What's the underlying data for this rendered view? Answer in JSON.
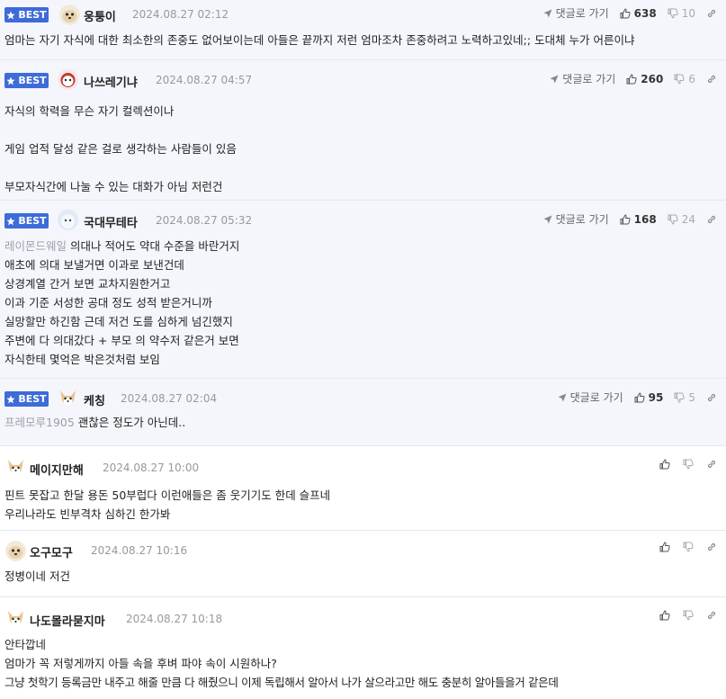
{
  "best_label": "BEST",
  "reply_label": "댓글로 가기",
  "comments": [
    {
      "nick": "웅퉁이",
      "date": "2024.08.27 02:12",
      "up": "638",
      "down": "10",
      "lines": [
        "엄마는 자기 자식에 대한 최소한의 존중도 없어보이는데 아들은 끝까지 저런 엄마조차 존중하려고 노력하고있네;; 도대체 누가 어른이냐"
      ]
    },
    {
      "nick": "나쓰레기냐",
      "date": "2024.08.27 04:57",
      "up": "260",
      "down": "6",
      "lines": [
        "자식의 학력을 무슨 자기 컬렉션이나",
        "게임 업적 달성 같은 걸로 생각하는 사람들이 있음",
        "부모자식간에 나눌 수 있는 대화가 아님 저런건"
      ]
    },
    {
      "nick": "국대무테타",
      "date": "2024.08.27 05:32",
      "up": "168",
      "down": "24",
      "mention": "레이몬드웨일",
      "lines": [
        "의대나 적어도 약대 수준을 바란거지",
        "애초에 의대 보낼거면 이과로 보낸건데",
        "상경계열 간거 보면 교차지원한거고",
        "이과 기준 서성한 공대 정도 성적 받은거니까",
        "실망할만 하긴함 근데 저건 도를 심하게 넘긴했지",
        "주변에 다 의대갔다 + 부모 의 약수저 같은거 보면",
        "자식한테 몇억은 박은것처럼 보임"
      ]
    },
    {
      "nick": "케칭",
      "date": "2024.08.27 02:04",
      "up": "95",
      "down": "5",
      "mention": "프레모루1905",
      "lines": [
        "괜찮은 정도가 아닌데.."
      ]
    },
    {
      "nick": "메이지만해",
      "date": "2024.08.27 10:00",
      "lines": [
        "핀트 못잡고 한달 용돈 50부럽다 이런애들은 좀 웃기기도 한데 슬프네",
        "우리나라도 빈부격차 심하긴 한가봐"
      ]
    },
    {
      "nick": "오구모구",
      "date": "2024.08.27 10:16",
      "lines": [
        "정병이네 저건"
      ]
    },
    {
      "nick": "나도몰라묻지마",
      "date": "2024.08.27 10:18",
      "lines": [
        "안타깝네",
        "엄마가 꼭 저렇게까지 아들 속을 후벼 파야 속이 시원하나?",
        "그냥 첫학기 등록금만 내주고 해줄 만큼 다 해줬으니 이제 독립해서 알아서 나가 살으라고만 해도 충분히 알아들을거 같은데"
      ]
    }
  ],
  "colors": {
    "best_badge": "#3d6bd9",
    "best_bg": "#f4f6fb",
    "meta": "#999999",
    "mention": "#9aa0aa"
  },
  "icons": [
    "star-icon",
    "reply-arrow-icon",
    "thumbs-up-icon",
    "thumbs-down-icon",
    "link-icon",
    "avatar-dog-icon"
  ]
}
